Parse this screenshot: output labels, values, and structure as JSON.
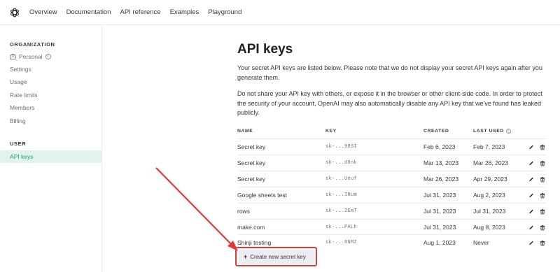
{
  "topbar": {
    "nav": [
      "Overview",
      "Documentation",
      "API reference",
      "Examples",
      "Playground"
    ]
  },
  "sidebar": {
    "org_header": "ORGANIZATION",
    "org_name": "Personal",
    "org_items": [
      "Settings",
      "Usage",
      "Rate limits",
      "Members",
      "Billing"
    ],
    "user_header": "USER",
    "user_items": [
      "API keys"
    ]
  },
  "main": {
    "title": "API keys",
    "para1": "Your secret API keys are listed below. Please note that we do not display your secret API keys again after you generate them.",
    "para2": "Do not share your API key with others, or expose it in the browser or other client-side code. In order to protect the security of your account, OpenAI may also automatically disable any API key that we've found has leaked publicly.",
    "columns": [
      "NAME",
      "KEY",
      "CREATED",
      "LAST USED"
    ],
    "rows": [
      {
        "name": "Secret key",
        "key": "sk-...98SI",
        "created": "Feb 6, 2023",
        "last_used": "Feb 7, 2023"
      },
      {
        "name": "Secret key",
        "key": "sk-...d8nk",
        "created": "Mar 13, 2023",
        "last_used": "Mar 26, 2023"
      },
      {
        "name": "Secret key",
        "key": "sk-...Ueuf",
        "created": "Mar 26, 2023",
        "last_used": "Apr 29, 2023"
      },
      {
        "name": "Google sheets test",
        "key": "sk-...IRum",
        "created": "Jul 31, 2023",
        "last_used": "Aug 2, 2023"
      },
      {
        "name": "rows",
        "key": "sk-...2EmT",
        "created": "Jul 31, 2023",
        "last_used": "Jul 31, 2023"
      },
      {
        "name": "make.com",
        "key": "sk-...PALh",
        "created": "Jul 31, 2023",
        "last_used": "Aug 8, 2023"
      },
      {
        "name": "Shinji testing",
        "key": "sk-...8NMZ",
        "created": "Aug 1, 2023",
        "last_used": "Never"
      }
    ],
    "create_button": "Create new secret key"
  },
  "colors": {
    "accent": "#10a37f",
    "active_bg": "#e3f2ef",
    "annotation": "#e53935"
  }
}
